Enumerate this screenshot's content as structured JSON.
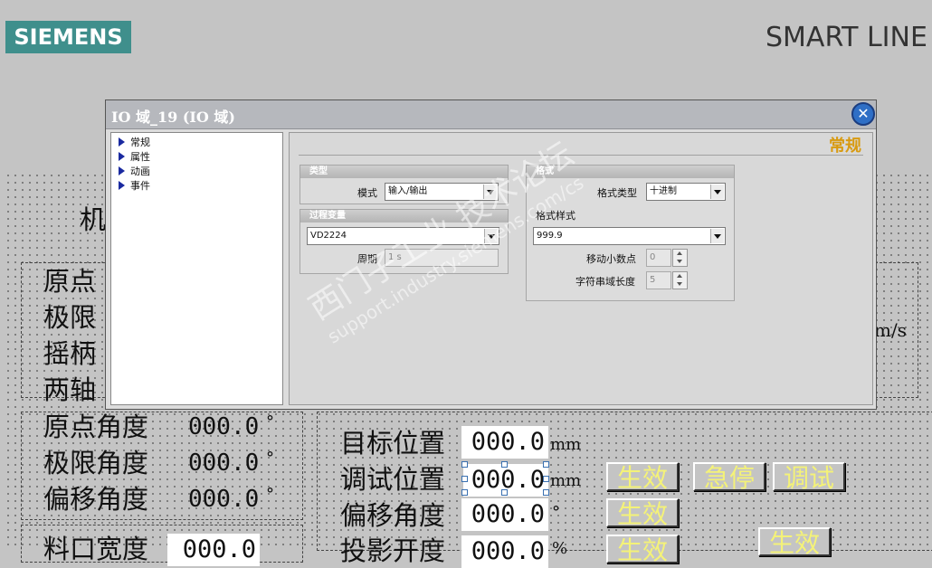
{
  "header": {
    "brand": "SIEMENS",
    "product": "SMART LINE"
  },
  "hmi": {
    "labels": {
      "l1": "机",
      "l2": "原点",
      "l3": "极限",
      "l4": "摇柄",
      "l5": "两轴",
      "origin_angle": "原点角度",
      "limit_angle": "极限角度",
      "offset_angle_left": "偏移角度",
      "material_width": "料口宽度",
      "target_pos": "目标位置",
      "debug_pos": "调试位置",
      "offset_angle": "偏移角度",
      "proj_width": "投影开度"
    },
    "values": {
      "origin_angle": "000.0",
      "limit_angle": "000.0",
      "offset_angle_left": "000.0",
      "material_width": "000.0",
      "target_pos": "000.0",
      "debug_pos": "000.0",
      "offset_angle": "000.0",
      "proj_width": "000.0"
    },
    "units": {
      "deg": "°",
      "mm": "mm",
      "ms": "m/s",
      "pct": "%"
    },
    "buttons": {
      "apply1": "生效",
      "estop": "急停",
      "debug": "调试",
      "apply2": "生效",
      "apply3": "生效",
      "apply4": "生效"
    }
  },
  "dialog": {
    "title": "IO 域_19 (IO 域)",
    "nav": [
      "常规",
      "属性",
      "动画",
      "事件"
    ],
    "section_title": "常规",
    "type_group": {
      "header": "类型",
      "mode_label": "模式",
      "mode_value": "输入/输出"
    },
    "tag_group": {
      "header": "过程变量",
      "tag_value": "VD2224",
      "period_label": "周期",
      "period_value": "1 s"
    },
    "format_group": {
      "header": "格式",
      "format_type_label": "格式类型",
      "format_type_value": "十进制",
      "format_pattern_label": "格式样式",
      "format_pattern_value": "999.9",
      "shift_decimal_label": "移动小数点",
      "shift_decimal_value": "0",
      "field_length_label": "字符串域长度",
      "field_length_value": "5"
    }
  },
  "watermark": {
    "line1": "西门子工业 技术论坛",
    "line2": "support.industry.siemens.com/cs"
  }
}
